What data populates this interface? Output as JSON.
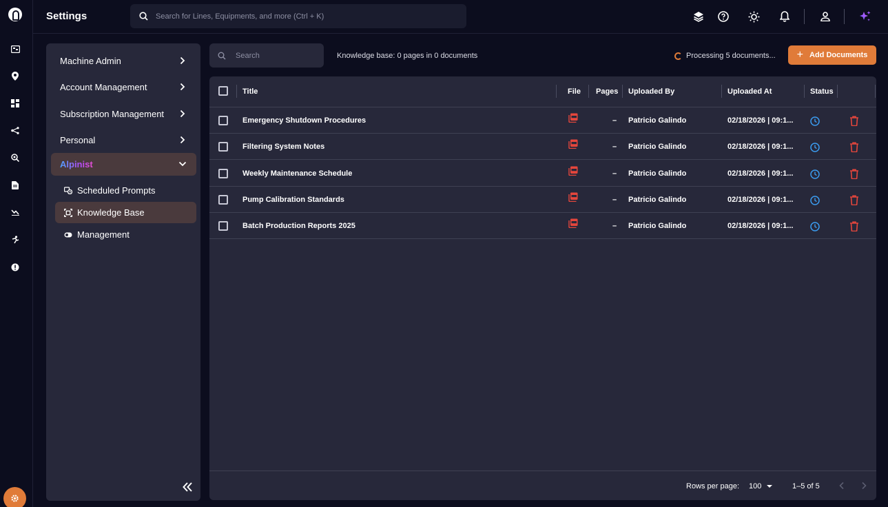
{
  "header": {
    "title": "Settings",
    "search_placeholder": "Search for Lines, Equipments, and more (Ctrl + K)"
  },
  "sidebar": {
    "items": [
      {
        "label": "Machine Admin"
      },
      {
        "label": "Account Management"
      },
      {
        "label": "Subscription Management"
      },
      {
        "label": "Personal"
      },
      {
        "label": "Alpinist"
      }
    ],
    "alpinist_sub_items": [
      {
        "label": "Scheduled Prompts",
        "icon": "scheduled-prompts-icon"
      },
      {
        "label": "Knowledge Base",
        "icon": "knowledge-base-icon"
      },
      {
        "label": "Management",
        "icon": "toggle-icon"
      }
    ]
  },
  "knowledge_base": {
    "search_placeholder": "Search",
    "info": "Knowledge base: 0 pages in 0 documents",
    "processing": "Processing 5 documents...",
    "add_button": "Add Documents"
  },
  "table": {
    "columns": [
      "Title",
      "File",
      "Pages",
      "Uploaded By",
      "Uploaded At",
      "Status"
    ],
    "rows": [
      {
        "title": "Emergency Shutdown Procedures",
        "pages": "–",
        "uploaded_by": "Patricio Galindo",
        "uploaded_at": "02/18/2026 | 09:1..."
      },
      {
        "title": "Filtering System Notes",
        "pages": "–",
        "uploaded_by": "Patricio Galindo",
        "uploaded_at": "02/18/2026 | 09:1..."
      },
      {
        "title": "Weekly Maintenance Schedule",
        "pages": "–",
        "uploaded_by": "Patricio Galindo",
        "uploaded_at": "02/18/2026 | 09:1..."
      },
      {
        "title": "Pump Calibration Standards",
        "pages": "–",
        "uploaded_by": "Patricio Galindo",
        "uploaded_at": "02/18/2026 | 09:1..."
      },
      {
        "title": "Batch Production Reports 2025",
        "pages": "–",
        "uploaded_by": "Patricio Galindo",
        "uploaded_at": "02/18/2026 | 09:1..."
      }
    ]
  },
  "pagination": {
    "rows_per_page_label": "Rows per page:",
    "rows_per_page_value": "100",
    "range": "1–5 of 5"
  },
  "colors": {
    "background": "#0c0d1e",
    "panel": "#27283a",
    "accent": "#e07b39",
    "danger": "#e5463c",
    "status_blue": "#3b9cf0",
    "active_row": "#4a3a3d"
  }
}
